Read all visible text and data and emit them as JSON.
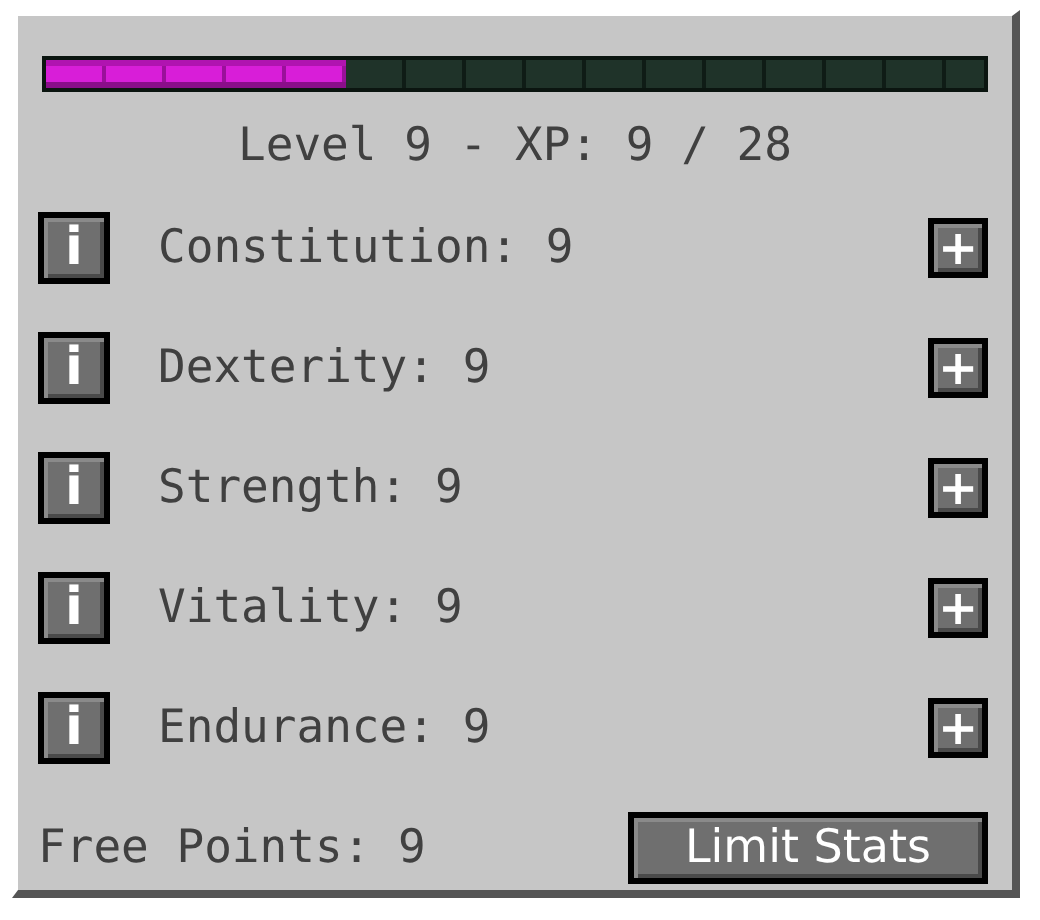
{
  "xp_bar": {
    "level": 0.32
  },
  "level_text": "Level 9 - XP: 9 / 28",
  "stats": [
    {
      "info_button": "i",
      "label": "Constitution: 9",
      "add_button": "+"
    },
    {
      "info_button": "i",
      "label": "Dexterity: 9",
      "add_button": "+"
    },
    {
      "info_button": "i",
      "label": "Strength: 9",
      "add_button": "+"
    },
    {
      "info_button": "i",
      "label": "Vitality: 9",
      "add_button": "+"
    },
    {
      "info_button": "i",
      "label": "Endurance: 9",
      "add_button": "+"
    }
  ],
  "free_points": "Free Points: 9",
  "limit_button": "Limit Stats"
}
